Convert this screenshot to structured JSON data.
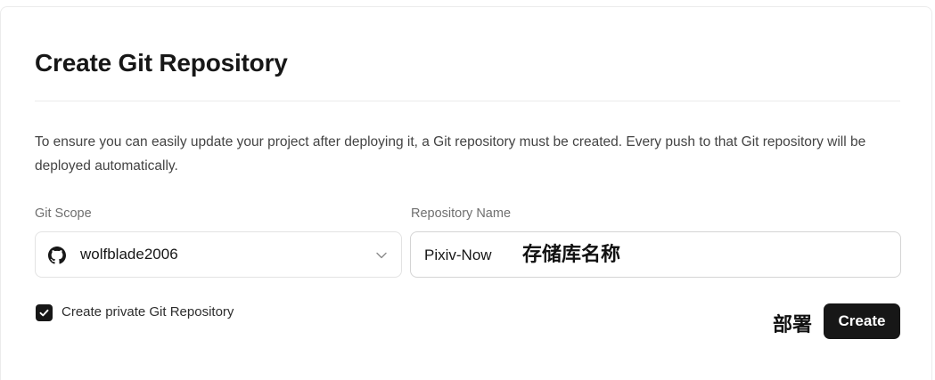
{
  "dialog": {
    "title": "Create Git Repository",
    "description": "To ensure you can easily update your project after deploying it, a Git repository must be created. Every push to that Git repository will be deployed automatically."
  },
  "git_scope": {
    "label": "Git Scope",
    "value": "wolfblade2006",
    "icon": "github-icon"
  },
  "repository_name": {
    "label": "Repository Name",
    "value": "Pixiv-Now"
  },
  "private_checkbox": {
    "label": "Create private Git Repository",
    "checked": true
  },
  "annotations": {
    "repo_name_note": "存储库名称",
    "deploy_note": "部署"
  },
  "actions": {
    "create_label": "Create"
  },
  "colors": {
    "primary": "#171717",
    "border": "#e3e3e3",
    "muted_text": "#6f6f6f"
  }
}
